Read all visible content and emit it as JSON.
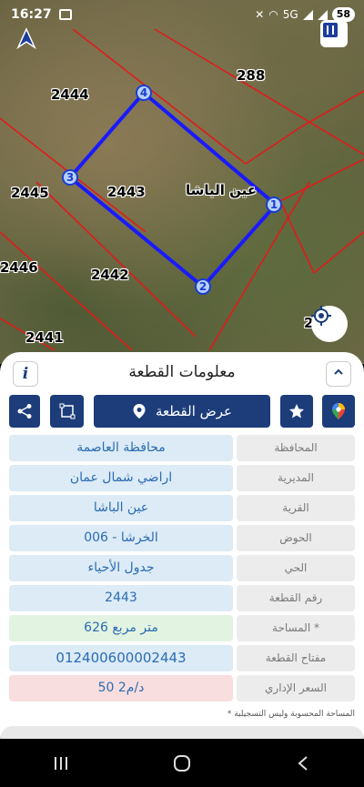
{
  "status_bar": {
    "time": "16:27",
    "network": "5G",
    "battery": "58"
  },
  "map": {
    "plot_labels": [
      {
        "id": "2444",
        "text": "2444"
      },
      {
        "id": "288",
        "text": "288"
      },
      {
        "id": "2445",
        "text": "2445"
      },
      {
        "id": "2443",
        "text": "2443"
      },
      {
        "id": "2446",
        "text": "2446"
      },
      {
        "id": "2442",
        "text": "2442"
      },
      {
        "id": "2441",
        "text": "2441"
      },
      {
        "id": "edge",
        "text": "2"
      }
    ],
    "village_label": "عين الباشا",
    "vertices": [
      "1",
      "2",
      "3",
      "4"
    ],
    "colors": {
      "selected_border": "#1a1aff",
      "parcel_lines": "#e01b1b"
    }
  },
  "panel": {
    "title": "معلومات القطعة",
    "info_label": "i",
    "toolbar": {
      "show_plot_label": "عرض القطعة"
    },
    "rows": [
      {
        "label": "المحافظة",
        "value": "محافظة العاصمة"
      },
      {
        "label": "المديرية",
        "value": "اراضي شمال عمان"
      },
      {
        "label": "القرية",
        "value": "عين الباشا"
      },
      {
        "label": "الحوض",
        "value": "الخرشا - 006"
      },
      {
        "label": "الحي",
        "value": "جدول الأحياء"
      },
      {
        "label": "رقم القطعة",
        "value": "2443"
      },
      {
        "label": "المساحة *",
        "value": "626  متر مربع"
      },
      {
        "label": "مفتاح القطعة",
        "value": "012400600002443"
      },
      {
        "label": "السعر الإداري",
        "value": "50 د/م2"
      }
    ],
    "footnote": "* المساحة المحسوبة وليس التسجيلية",
    "colors": {
      "accent": "#1c3d7a",
      "value_text": "#2a6cb2"
    }
  }
}
